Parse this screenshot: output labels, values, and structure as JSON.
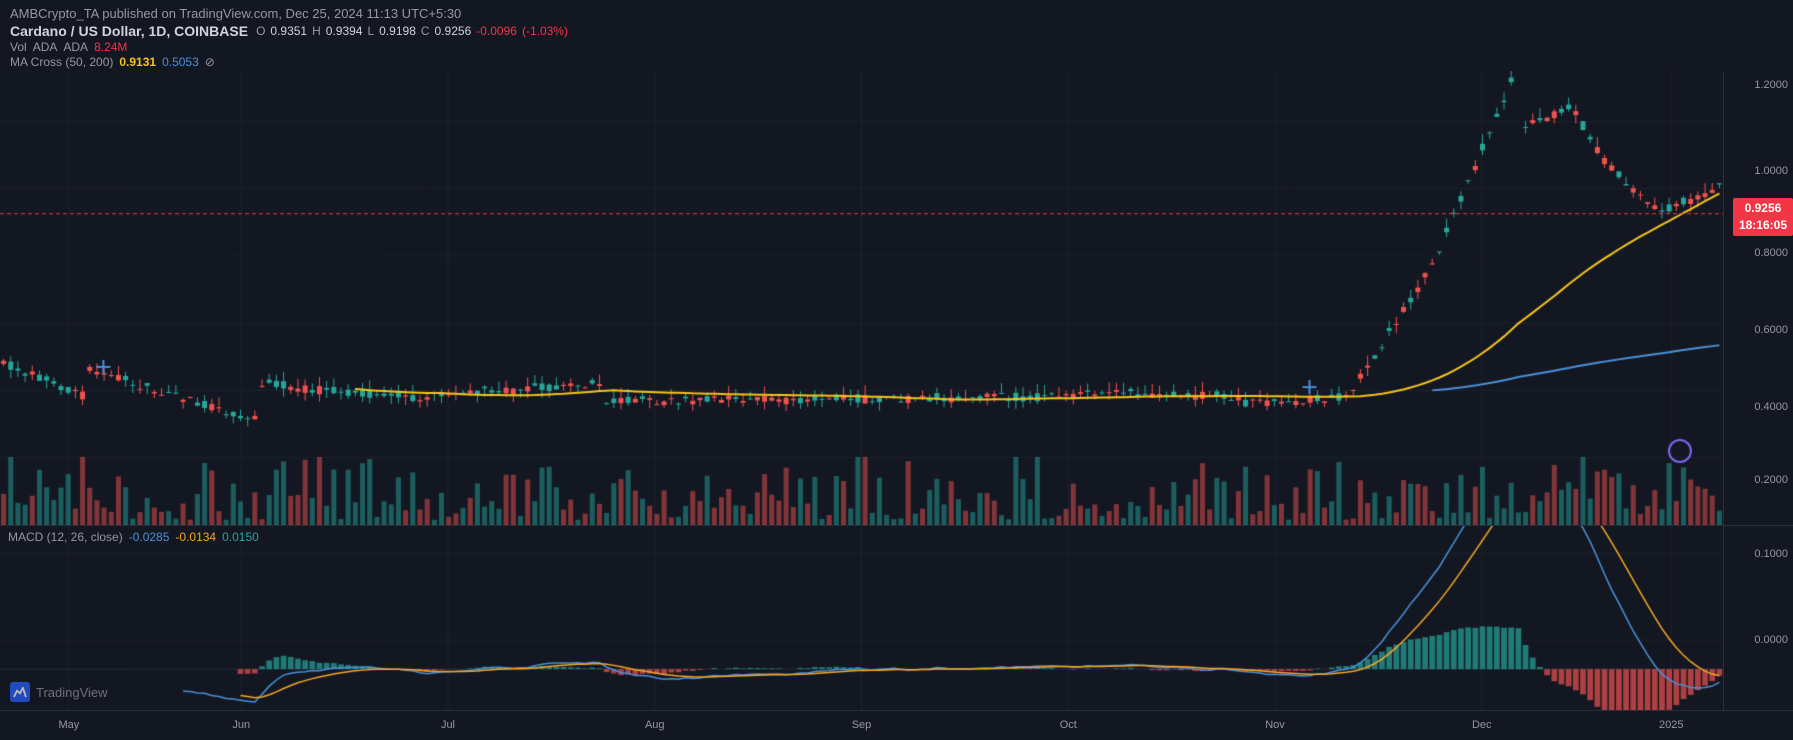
{
  "header": {
    "attribution": "AMBCrypto_TA published on TradingView.com, Dec 25, 2024 11:13 UTC+5:30",
    "pair": "Cardano / US Dollar, 1D, COINBASE",
    "ohlc": {
      "o_label": "O",
      "o_value": "0.9351",
      "h_label": "H",
      "h_value": "0.9394",
      "l_label": "L",
      "l_value": "0.9198",
      "c_label": "C",
      "c_value": "0.9256",
      "change": "-0.0096",
      "change_pct": "(-1.03%)"
    },
    "vol_label": "Vol",
    "vol_unit": "ADA",
    "vol_value": "8.24M",
    "ma_label": "MA Cross (50, 200)",
    "ma_val1": "0.9131",
    "ma_val2": "0.5053",
    "currency": "USD"
  },
  "price_axis": {
    "labels": [
      "1.2000",
      "1.0000",
      "0.8000",
      "0.6000",
      "0.4000",
      "0.2000"
    ],
    "current_price": "0.9256",
    "current_time": "18:16:05"
  },
  "macd": {
    "label": "MACD (12, 26, close)",
    "val1": "-0.0285",
    "val2": "-0.0134",
    "val3": "0.0150",
    "y_labels": [
      "0.1000",
      "0.0000"
    ]
  },
  "x_axis": {
    "labels": [
      "May",
      "Jun",
      "Jul",
      "Aug",
      "Sep",
      "Oct",
      "Nov",
      "Dec",
      "2025"
    ]
  },
  "colors": {
    "background": "#131722",
    "grid": "#1e222d",
    "border": "#2a2e39",
    "text": "#9598a1",
    "candle_up": "#26a69a",
    "candle_down": "#ef5350",
    "ma50": "#f5c518",
    "ma200": "#4a90d9",
    "price_badge": "#f23645",
    "macd_line": "#4a90d9",
    "signal_line": "#f5a623",
    "histogram_up": "#26a69a",
    "histogram_down": "#ef5350"
  }
}
